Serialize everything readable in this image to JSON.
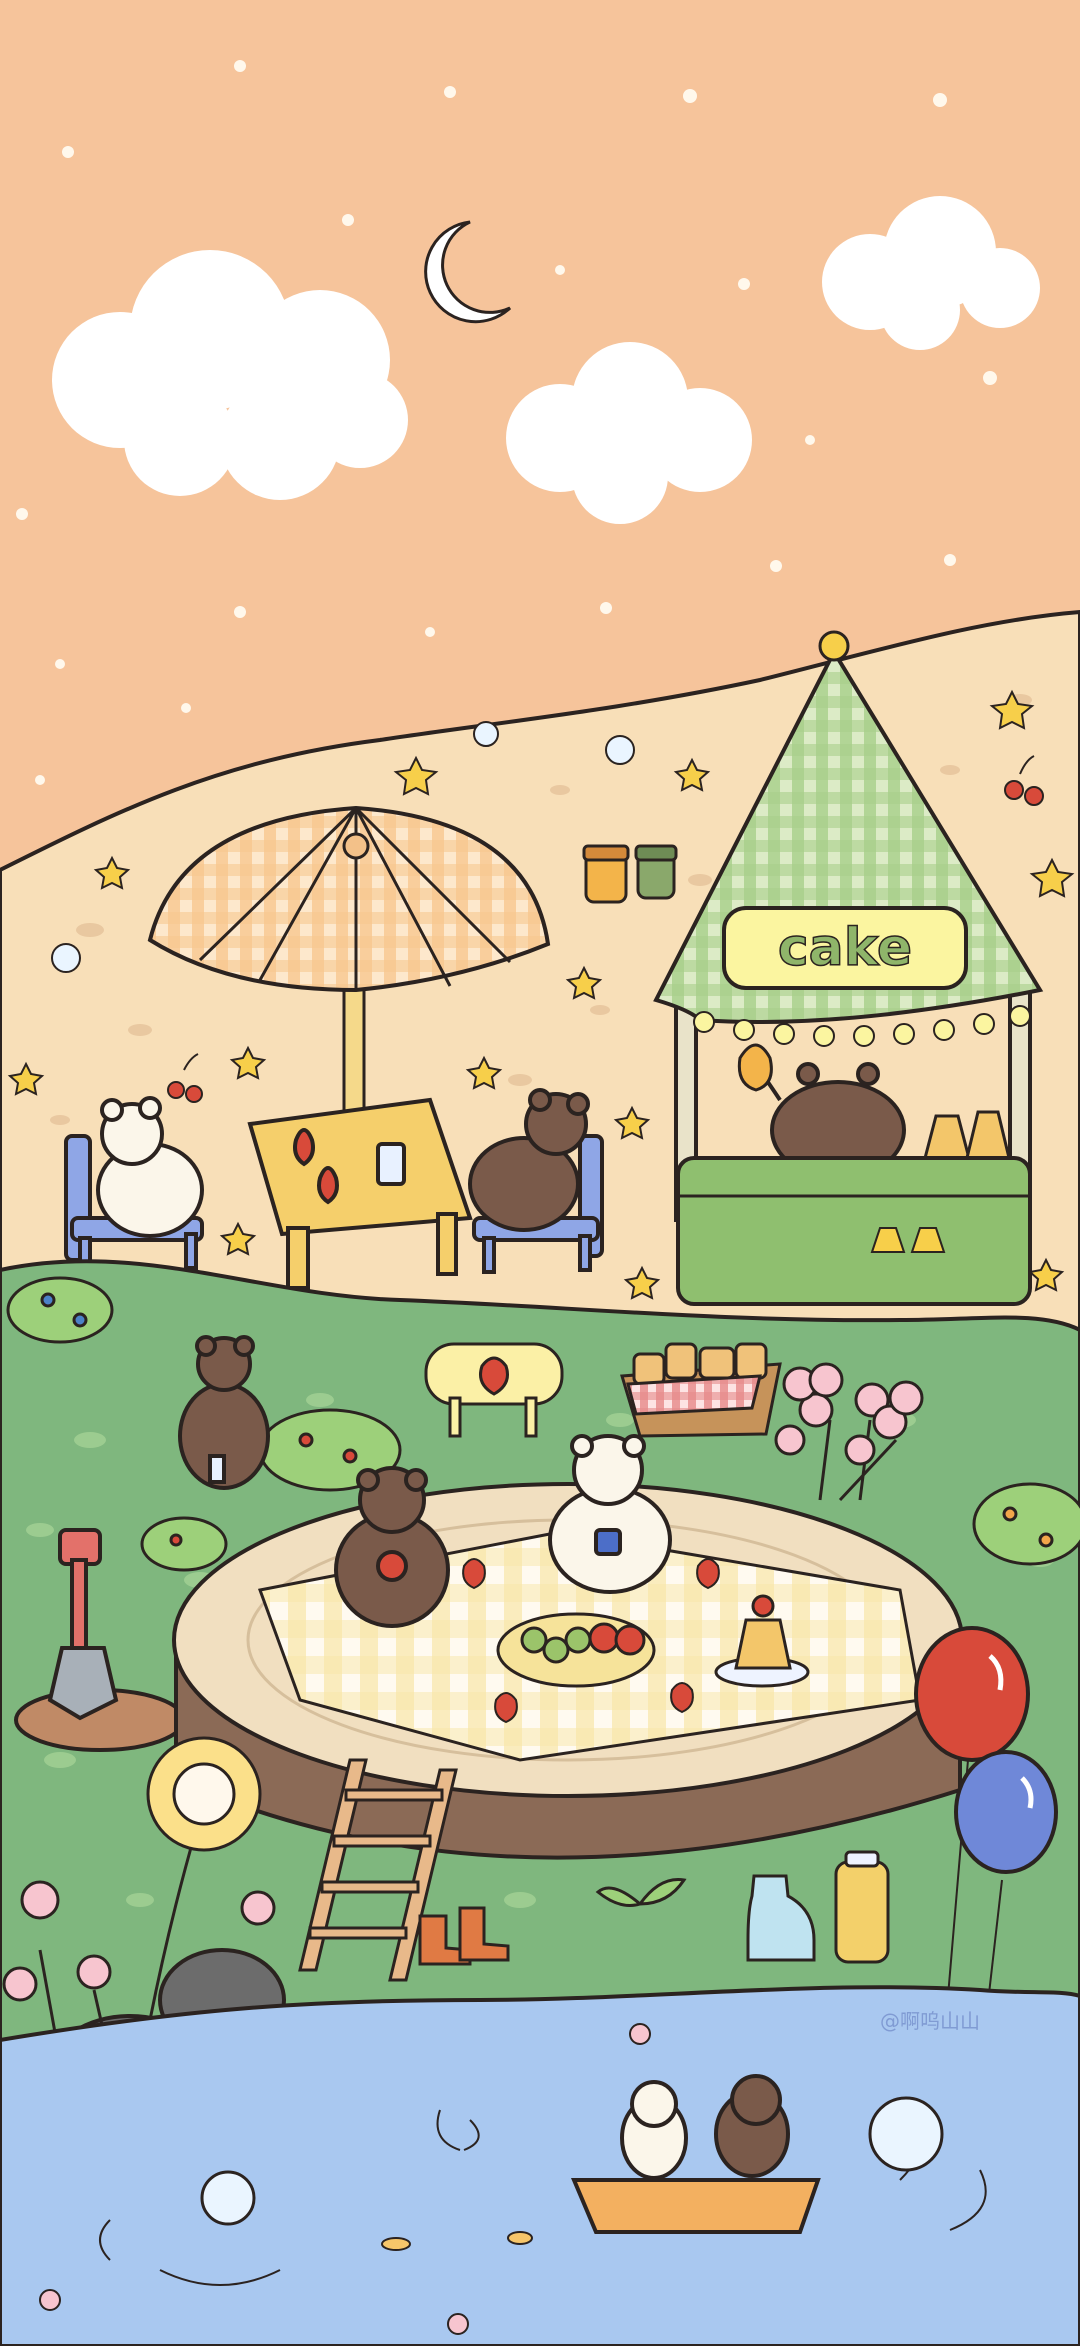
{
  "scene": {
    "sign_text": "cake",
    "watermark": "@啊呜山山"
  },
  "palette": {
    "sky": "#f6c49b",
    "sand": "#f8dfb8",
    "grass": "#7fb77e",
    "water": "#a9c8f0",
    "stall_green": "#8fbf6f",
    "checker": "#f3c189",
    "outline": "#2b2320"
  }
}
